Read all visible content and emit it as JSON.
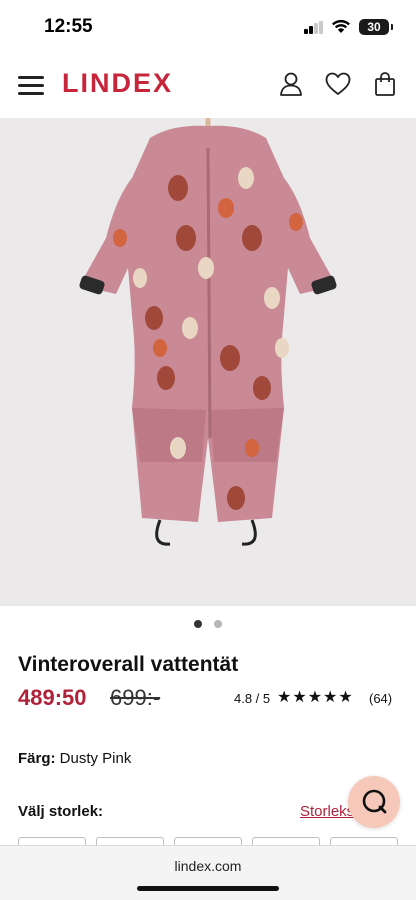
{
  "status_bar": {
    "time": "12:55",
    "battery": "30"
  },
  "header": {
    "brand": "LINDEX",
    "icons": [
      "menu-icon",
      "account-icon",
      "heart-icon",
      "bag-icon"
    ]
  },
  "gallery": {
    "image_count": 2,
    "active_index": 0
  },
  "product": {
    "title": "Vinteroverall vattentät",
    "price_sale": "489:50",
    "price_original": "699:-",
    "rating_score": "4.8 / 5",
    "stars": "★★★★★",
    "rating_count": "(64)",
    "color_label": "Färg:",
    "color_value": "Dusty Pink",
    "size_label": "Välj storlek:",
    "size_guide": "Storleksguide"
  },
  "browser": {
    "url": "lindex.com"
  },
  "colors": {
    "brand": "#c6253b",
    "sale_price": "#b0223a",
    "chat_button": "#f5c8ba",
    "image_background": "#ebe9ea",
    "suit_pink": "#c98a95"
  }
}
